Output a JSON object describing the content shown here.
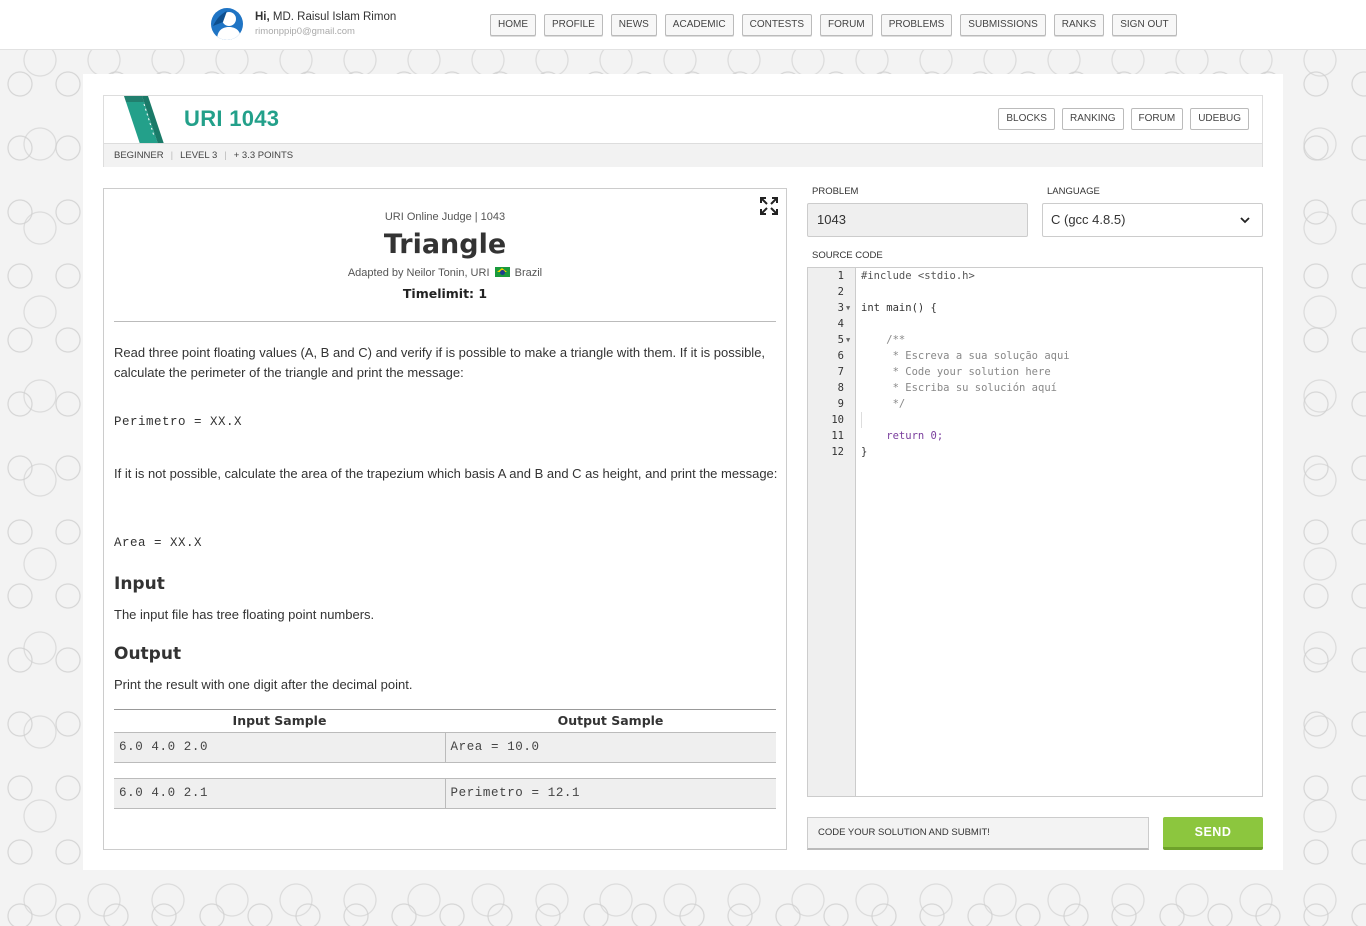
{
  "colors": {
    "brand": "#23a08a",
    "send": "#8cc63e",
    "avatar": "#1f74c4"
  },
  "user": {
    "greeting_prefix": "Hi,",
    "name": "MD. Raisul Islam Rimon",
    "email": "rimonppip0@gmail.com"
  },
  "nav": {
    "items": [
      "HOME",
      "PROFILE",
      "NEWS",
      "ACADEMIC",
      "CONTESTS",
      "FORUM",
      "PROBLEMS",
      "SUBMISSIONS",
      "RANKS",
      "SIGN OUT"
    ]
  },
  "header": {
    "code": "URI 1043",
    "actions": [
      "BLOCKS",
      "RANKING",
      "FORUM",
      "UDEBUG"
    ],
    "category": "BEGINNER",
    "level": "LEVEL 3",
    "points": "+ 3.3 POINTS"
  },
  "problem": {
    "judge_line": "URI Online Judge | 1043",
    "title": "Triangle",
    "adapted_prefix": "Adapted by Neilor Tonin, URI",
    "country": "Brazil",
    "timelimit": "Timelimit: 1",
    "para1": "Read three point floating values (A, B and C) and verify if is possible to make a triangle with them. If it is possible, calculate the perimeter of the triangle and print the message:",
    "code1": "Perimetro = XX.X",
    "para2": "If it is not possible, calculate the area of the trapezium which basis A and B and C as height, and print the message:",
    "code2": "Area = XX.X",
    "input_heading": "Input",
    "input_text": "The input file has tree floating point numbers.",
    "output_heading": "Output",
    "output_text": "Print the result with one digit after the decimal point.",
    "samples": {
      "input_header": "Input Sample",
      "output_header": "Output Sample",
      "rows": [
        {
          "input": "6.0 4.0 2.0",
          "output": "Area = 10.0"
        },
        {
          "input": "6.0 4.0 2.1",
          "output": "Perimetro = 12.1"
        }
      ]
    }
  },
  "submit": {
    "problem_label": "PROBLEM",
    "problem_value": "1043",
    "language_label": "LANGUAGE",
    "language_value": "C (gcc 4.8.5)",
    "source_label": "SOURCE CODE",
    "hint": "CODE YOUR SOLUTION AND SUBMIT!",
    "send_label": "SEND"
  },
  "editor": {
    "lines": [
      "#include <stdio.h>",
      "",
      "int main() {",
      "",
      "    /**",
      "     * Escreva a sua solução aqui",
      "     * Code your solution here",
      "     * Escriba su solución aquí",
      "     */",
      "",
      "    return 0;",
      "}"
    ],
    "line_numbers": [
      "1",
      "2",
      "3",
      "4",
      "5",
      "6",
      "7",
      "8",
      "9",
      "10",
      "11",
      "12"
    ]
  }
}
